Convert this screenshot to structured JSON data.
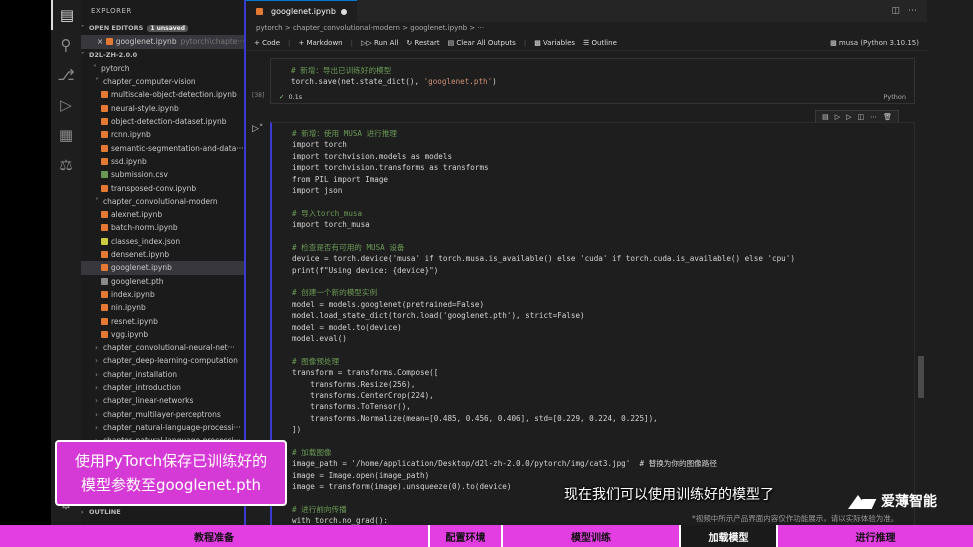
{
  "sidebar": {
    "explorer_title": "EXPLORER",
    "open_editors": "OPEN EDITORS",
    "unsaved_badge": "1 unsaved",
    "open_file": "googlenet.ipynb",
    "open_file_path": "pytorch\\chapte···",
    "root": "D2L-ZH-2.0.0",
    "items": [
      {
        "label": "pytorch",
        "kind": "folder"
      },
      {
        "label": "chapter_computer-vision",
        "kind": "folder"
      },
      {
        "label": "multiscale-object-detection.ipynb",
        "kind": "nb"
      },
      {
        "label": "neural-style.ipynb",
        "kind": "nb"
      },
      {
        "label": "object-detection-dataset.ipynb",
        "kind": "nb"
      },
      {
        "label": "rcnn.ipynb",
        "kind": "nb"
      },
      {
        "label": "semantic-segmentation-and-data···",
        "kind": "nb"
      },
      {
        "label": "ssd.ipynb",
        "kind": "nb"
      },
      {
        "label": "submission.csv",
        "kind": "csv"
      },
      {
        "label": "transposed-conv.ipynb",
        "kind": "nb"
      },
      {
        "label": "chapter_convolutional-modern",
        "kind": "folder"
      },
      {
        "label": "alexnet.ipynb",
        "kind": "nb"
      },
      {
        "label": "batch-norm.ipynb",
        "kind": "nb"
      },
      {
        "label": "classes_index.json",
        "kind": "json"
      },
      {
        "label": "densenet.ipynb",
        "kind": "nb"
      },
      {
        "label": "googlenet.ipynb",
        "kind": "nb",
        "selected": true
      },
      {
        "label": "googlenet.pth",
        "kind": "pth"
      },
      {
        "label": "index.ipynb",
        "kind": "nb"
      },
      {
        "label": "nin.ipynb",
        "kind": "nb"
      },
      {
        "label": "resnet.ipynb",
        "kind": "nb"
      },
      {
        "label": "vgg.ipynb",
        "kind": "nb"
      },
      {
        "label": "chapter_convolutional-neural-net···",
        "kind": "collapsed"
      },
      {
        "label": "chapter_deep-learning-computation",
        "kind": "collapsed"
      },
      {
        "label": "chapter_installation",
        "kind": "collapsed"
      },
      {
        "label": "chapter_introduction",
        "kind": "collapsed"
      },
      {
        "label": "chapter_linear-networks",
        "kind": "collapsed"
      },
      {
        "label": "chapter_multilayer-perceptrons",
        "kind": "collapsed"
      },
      {
        "label": "chapter_natural-language-processi···",
        "kind": "collapsed"
      },
      {
        "label": "chapter_natural-language-processi···",
        "kind": "collapsed"
      }
    ],
    "outline": "OUTLINE"
  },
  "editor": {
    "tab_label": "googlenet.ipynb",
    "breadcrumb": "pytorch > chapter_convolutional-modern > googlenet.ipynb > ···",
    "toolbar": {
      "code": "+ Code",
      "markdown": "+ Markdown",
      "run_all": "Run All",
      "restart": "Restart",
      "clear": "Clear All Outputs",
      "variables": "Variables",
      "outline": "Outline",
      "kernel": "musa (Python 3.10.15)"
    },
    "cell1": {
      "exec_count": "[38]",
      "line1": "# 新增：导出已训练好的模型",
      "line2_a": "torch.save(net.state_dict(), ",
      "line2_b": "'googlenet.pth'",
      "line2_c": ")",
      "status": "0.1s",
      "lang": "Python"
    },
    "cell2_lines": [
      "# 新增：使用 MUSA 进行推理",
      "import torch",
      "import torchvision.models as models",
      "import torchvision.transforms as transforms",
      "from PIL import Image",
      "import json",
      "",
      "# 导入torch_musa",
      "import torch_musa",
      "",
      "# 检查是否有可用的 MUSA 设备",
      "device = torch.device('musa' if torch.musa.is_available() else 'cuda' if torch.cuda.is_available() else 'cpu')",
      "print(f\"Using device: {device}\")",
      "",
      "# 创建一个新的模型实例",
      "model = models.googlenet(pretrained=False)",
      "model.load_state_dict(torch.load('googlenet.pth'), strict=False)",
      "model = model.to(device)",
      "model.eval()",
      "",
      "# 图像预处理",
      "transform = transforms.Compose([",
      "    transforms.Resize(256),",
      "    transforms.CenterCrop(224),",
      "    transforms.ToTensor(),",
      "    transforms.Normalize(mean=[0.485, 0.456, 0.406], std=[0.229, 0.224, 0.225]),",
      "])",
      "",
      "# 加载图像",
      "image_path = '/home/application/Desktop/d2l-zh-2.0.0/pytorch/img/cat3.jpg'  # 替换为你的图像路径",
      "image = Image.open(image_path)",
      "image = transform(image).unsqueeze(0).to(device)",
      "",
      "# 进行前向传播",
      "with torch.no_grad():"
    ]
  },
  "overlay": {
    "caption_line1": "使用PyTorch保存已训练好的",
    "caption_line2": "模型参数至googlenet.pth",
    "subtitle": "现在我们可以使用训练好的模型了",
    "brand": "爱薄智能",
    "disclaimer": "*视频中所示产品界面内容仅作功能展示，请以实际体验为准。"
  },
  "navbar": {
    "items": [
      "教程准备",
      "配置环境",
      "模型训练",
      "加载模型",
      "进行推理"
    ],
    "active_index": 3
  },
  "colors": {
    "accent_magenta": "#e23ee2",
    "caption_bg": "#d63ad6",
    "editor_bg": "#1e1e1e",
    "guide_blue": "#3a3ad0"
  }
}
